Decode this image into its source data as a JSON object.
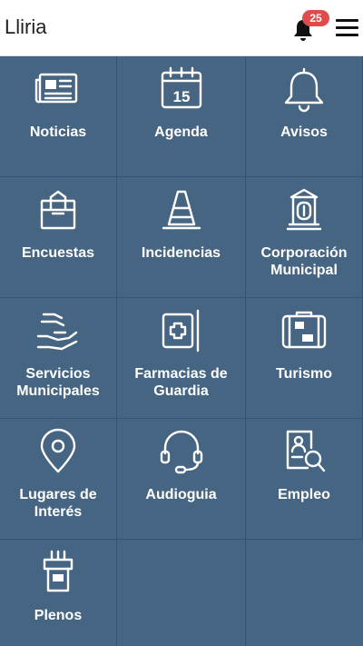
{
  "app": {
    "title": "Lliria"
  },
  "header": {
    "notification_count": "25"
  },
  "colors": {
    "tile_bg": "#466582",
    "badge": "#e04b4b"
  },
  "tiles": [
    {
      "label": "Noticias",
      "icon": "newspaper-icon"
    },
    {
      "label": "Agenda",
      "icon": "calendar-icon",
      "icon_text": "15"
    },
    {
      "label": "Avisos",
      "icon": "bell-icon"
    },
    {
      "label": "Encuestas",
      "icon": "ballot-box-icon"
    },
    {
      "label": "Incidencias",
      "icon": "traffic-cone-icon"
    },
    {
      "label": "Corporación Municipal",
      "icon": "town-hall-icon"
    },
    {
      "label": "Servicios Municipales",
      "icon": "helping-hand-icon"
    },
    {
      "label": "Farmacias de Guardia",
      "icon": "pharmacy-icon"
    },
    {
      "label": "Turismo",
      "icon": "suitcase-icon"
    },
    {
      "label": "Lugares de Interés",
      "icon": "map-pin-icon"
    },
    {
      "label": "Audioguia",
      "icon": "headset-icon"
    },
    {
      "label": "Empleo",
      "icon": "resume-search-icon"
    },
    {
      "label": "Plenos",
      "icon": "podium-icon"
    }
  ]
}
